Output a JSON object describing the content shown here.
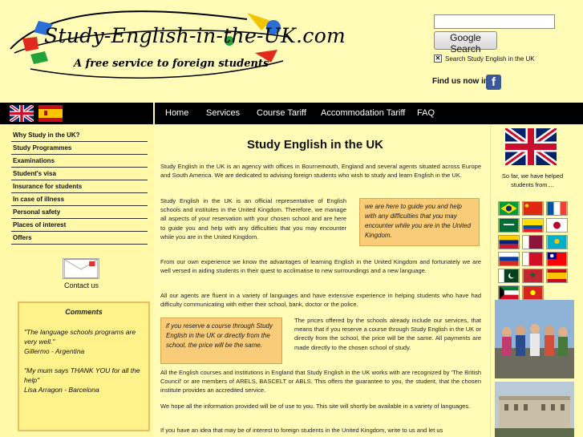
{
  "header": {
    "logo_title": "Study-English-in-the-UK.com",
    "logo_tagline": "A free service to foreign students",
    "search_button": "Google Search",
    "search_scope_label": "Search Study English in the UK",
    "find_us_label": "Find us now in",
    "facebook_icon": "facebook-icon"
  },
  "nav": {
    "language_flags": [
      "uk-flag-icon",
      "spain-flag-icon"
    ],
    "items": [
      "Home",
      "Services",
      "Course Tariff",
      "Accommodation Tariff",
      "FAQ"
    ]
  },
  "sidebar": {
    "items": [
      "Why Study in the UK?",
      "Study Programmes",
      "Examinations",
      "Student's visa",
      "Insurance for students",
      "In case of illness",
      "Personal safety",
      "Places of interest",
      "Offers"
    ],
    "contact_label": "Contact us",
    "comments": {
      "title": "Comments",
      "entries": [
        {
          "quote": "\"The language schools programs are very well.\"",
          "author": "Gillermo - Argentina"
        },
        {
          "quote": "\"My mum says THANK YOU for all the help\"",
          "author": "Lisa Arragon - Barcelona"
        }
      ]
    }
  },
  "main": {
    "title": "Study English in the UK",
    "para1": "Study English in the UK is an agency with offices in Bournemouth, England and several agents situated across Europe and South America. We are dedicated to advising foreign students who wish to study and learn English in the UK.",
    "para2": "Study English in the UK is an official representative of English schools and institutes in the United Kingdom. Therefore, we manage all aspects of your reservation with your chosen school and are here to guide you and help with any difficulties that you may encounter while you are in the United Kingdom.",
    "callout1": "we are here to guide you and help with any difficulties that you may encounter while you are in the United Kingdom.",
    "para3": "From our own experience we know the advantages of learning English in the United Kingdom and fortunately we are well versed in aiding students in their quest to acclimatise to new surroundings and a new language.",
    "para4": "All our agents are fluent in a variety of languages and have extensive experience in helping students who have had difficulty communicating with either their school, bank, doctor or the police.",
    "callout2": "if you reserve a course through Study English in the UK or directly from the school, the price will be the same.",
    "para5": "The prices offered by the schools already include our services, that means that if you reserve a course through Study English in the UK or directly from the school, the price will be the same. All payments are made directly to the chosen school of study.",
    "para6": "All the English courses and institutions in England that Study English in the UK works with are recognized by 'The British Council' or are members of ARELS, BASCELT or ABLS. This offers the guarantee to you, the student, that the chosen institute provides an accredited service.",
    "para7": "We hope all the information provided will be of use to you. This site will shortly be available in a variety of languages.",
    "para8": "If you have an idea that may be of interest to foreign students in the United Kingdom, write to us and let us"
  },
  "right": {
    "big_flag": "uk-flag-icon",
    "so_far_text": "So far, we have helped students from....",
    "flags": [
      "brazil",
      "china",
      "france",
      "saudi-arabia",
      "ecuador",
      "japan",
      "venezuela",
      "qatar",
      "kazakhstan",
      "russia",
      "bahrain",
      "taiwan",
      "pakistan",
      "morocco",
      "spain",
      "kuwait",
      "vietnam"
    ]
  }
}
